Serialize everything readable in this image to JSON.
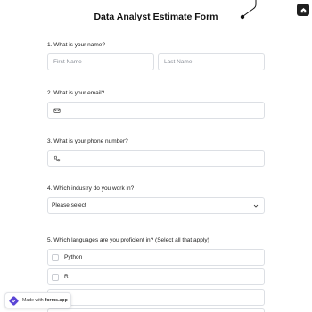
{
  "form": {
    "title": "Data Analyst Estimate Form"
  },
  "questions": {
    "q1": {
      "label": "1.  What is your name?",
      "first_placeholder": "First Name",
      "last_placeholder": "Last Name"
    },
    "q2": {
      "label": "2. What is your email?",
      "icon": "envelope-icon"
    },
    "q3": {
      "label": "3. What is your phone number?",
      "icon": "phone-icon"
    },
    "q4": {
      "label": "4. Which industry do you work in?",
      "selected": "Please select",
      "icon": "chevron-down-icon"
    },
    "q5": {
      "label": "5. Which languages are you proficient in? (Select all that apply)",
      "options": [
        "Python",
        "R",
        "",
        ""
      ]
    }
  },
  "badge": {
    "prefix": "Made with",
    "brand": "forms.app",
    "icon": "forms-app-logo"
  },
  "corner_button": {
    "icon": "home-icon"
  },
  "colors": {
    "accent": "#5b45d6",
    "border": "#dcdfe4",
    "title": "#111111"
  }
}
